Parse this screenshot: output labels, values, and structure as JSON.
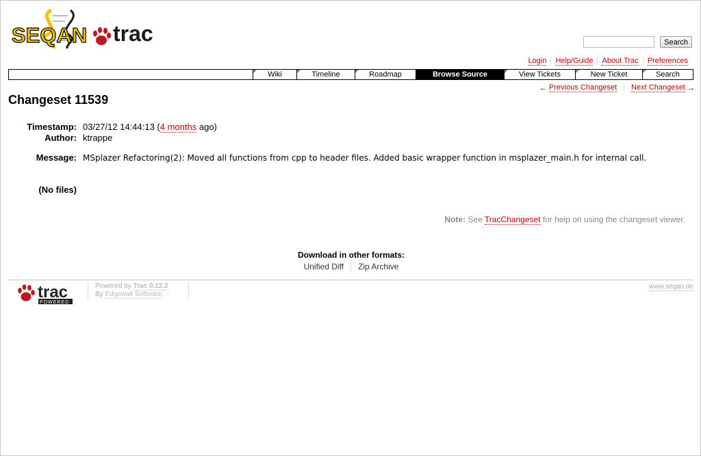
{
  "header": {
    "logo_text_left": "SEQAN",
    "logo_text_right": "trac",
    "search_placeholder": "",
    "search_button": "Search"
  },
  "metanav": [
    "Login",
    "Help/Guide",
    "About Trac",
    "Preferences"
  ],
  "mainnav": {
    "tabs": [
      "Wiki",
      "Timeline",
      "Roadmap",
      "Browse Source",
      "View Tickets",
      "New Ticket",
      "Search"
    ],
    "active": "Browse Source"
  },
  "ctxtnav": {
    "prev_arrow": "←",
    "prev_label": "Previous Changeset",
    "next_label": "Next Changeset",
    "next_arrow": "→"
  },
  "page_title": "Changeset 11539",
  "props": {
    "timestamp_label": "Timestamp:",
    "timestamp_value": "03/27/12 14:44:13 (",
    "timestamp_link": "4 months",
    "timestamp_suffix": " ago)",
    "author_label": "Author:",
    "author_value": "ktrappe",
    "message_label": "Message:",
    "message_value": "MSplazer Refactoring(2): Moved all functions from cpp to header files. Added basic wrapper function in msplazer_main.h for internal call."
  },
  "no_files": "(No files)",
  "help": {
    "note_label": "Note:",
    "prefix": " See ",
    "link": "TracChangeset",
    "suffix": " for help on using the changeset viewer."
  },
  "altlinks": {
    "title": "Download in other formats:",
    "items": [
      "Unified Diff",
      "Zip Archive"
    ]
  },
  "footer": {
    "trac_logo_text": "trac",
    "trac_logo_sub": "POWERED",
    "powered_by": "Powered by ",
    "trac_version": "Trac 0.12.2",
    "by": "By ",
    "edgewall": "Edgewall Software",
    "period": ".",
    "site": "www.seqan.de"
  },
  "colors": {
    "link": "#bb0000",
    "logo_yellow": "#f2c200",
    "paw_red": "#c0171e"
  }
}
